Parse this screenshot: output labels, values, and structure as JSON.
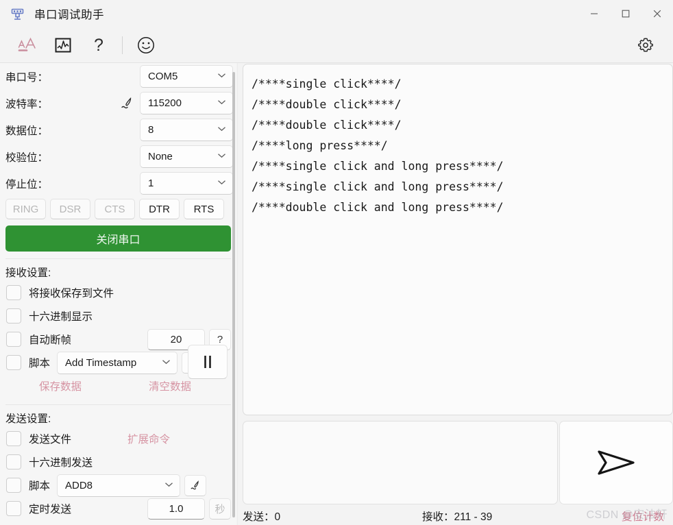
{
  "window": {
    "title": "串口调试助手",
    "app_icon": "serial-port-icon",
    "controls": {
      "minimize": "—",
      "maximize": "▢",
      "close": "✕"
    }
  },
  "toolbar": {
    "items": [
      {
        "name": "font-size-icon",
        "label": "AA",
        "color": "#c98d9c"
      },
      {
        "name": "waveform-chart-icon",
        "label": "chart"
      },
      {
        "name": "help-icon",
        "label": "?"
      },
      {
        "name": "smiley-icon",
        "label": "☺"
      }
    ],
    "settings_icon": "gear-icon"
  },
  "serial": {
    "fields": [
      {
        "label": "串口号：",
        "value": "COM5",
        "pen": false
      },
      {
        "label": "波特率：",
        "value": "115200",
        "pen": true
      },
      {
        "label": "数据位：",
        "value": "8",
        "pen": false
      },
      {
        "label": "校验位：",
        "value": "None",
        "pen": false
      },
      {
        "label": "停止位：",
        "value": "1",
        "pen": false
      }
    ],
    "flags": [
      {
        "label": "RING",
        "enabled": false
      },
      {
        "label": "DSR",
        "enabled": false
      },
      {
        "label": "CTS",
        "enabled": false
      },
      {
        "label": "DTR",
        "enabled": true
      },
      {
        "label": "RTS",
        "enabled": true
      }
    ],
    "toggle_button": "关闭串口",
    "toggle_color": "#2f9233"
  },
  "receive_settings": {
    "title": "接收设置:",
    "save_to_file": "将接收保存到文件",
    "hex_display": "十六进制显示",
    "auto_frame": "自动断帧",
    "auto_frame_value": "20",
    "auto_frame_help": "?",
    "script": "脚本",
    "script_value": "Add Timestamp",
    "pause_icon": "pause-icon",
    "edit_icon": "pen-edit-icon",
    "save_data_link": "保存数据",
    "clear_data_link": "清空数据",
    "link_color": "#d694a3"
  },
  "send_settings": {
    "title": "发送设置:",
    "send_file": "发送文件",
    "extended_cmd_link": "扩展命令",
    "hex_send": "十六进制发送",
    "script": "脚本",
    "script_value": "ADD8",
    "edit_icon": "pen-edit-icon",
    "timed_send": "定时发送",
    "timed_value": "1.0",
    "timed_unit": "秒"
  },
  "receive_area": {
    "lines": [
      "/****single click****/",
      "/****double click****/",
      "/****double click****/",
      "/****long press****/",
      "/****single click and long press****/",
      "/****single click and long press****/",
      "/****double click and long press****/"
    ]
  },
  "send_area": {
    "value": "",
    "placeholder": "",
    "send_icon": "send-paper-plane-icon"
  },
  "statusbar": {
    "sent": "发送：0",
    "received": "接收：211 - 39",
    "reset": "复位计数"
  },
  "watermark": {
    "text": "CSDN @安法轩"
  }
}
